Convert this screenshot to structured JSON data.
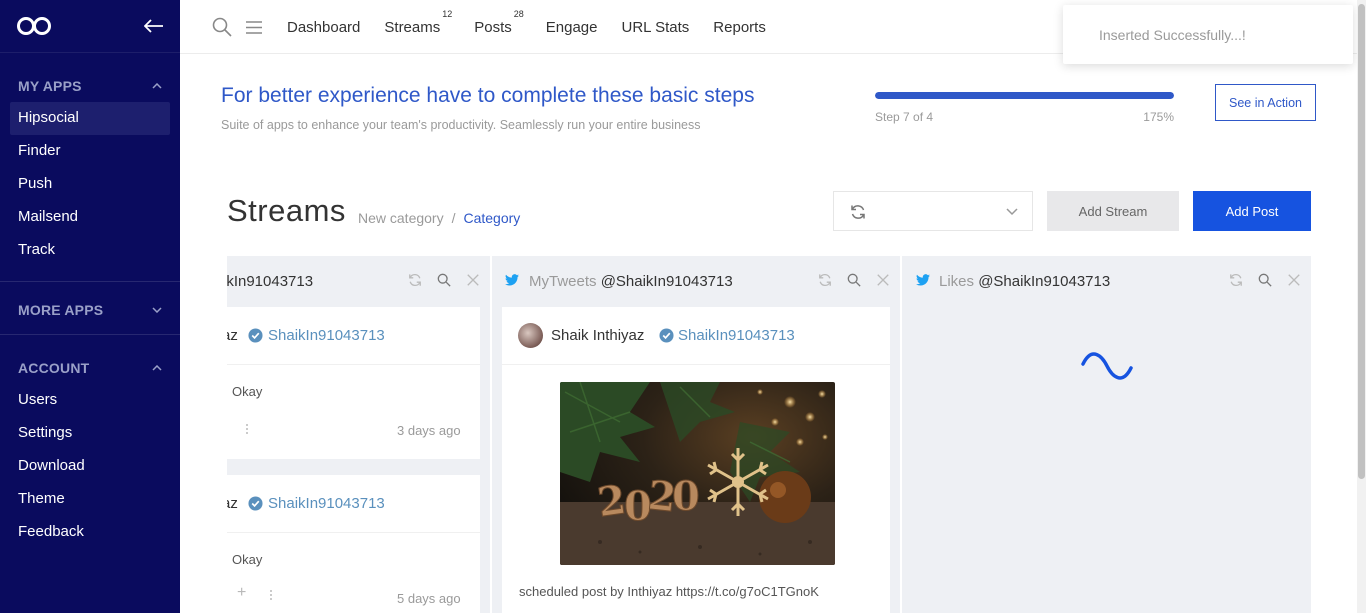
{
  "sidebar": {
    "sections": [
      {
        "title": "MY APPS",
        "items": [
          "Hipsocial",
          "Finder",
          "Push",
          "Mailsend",
          "Track"
        ]
      },
      {
        "title": "MORE APPS",
        "items": []
      },
      {
        "title": "ACCOUNT",
        "items": [
          "Users",
          "Settings",
          "Download",
          "Theme",
          "Feedback"
        ]
      }
    ]
  },
  "topnav": {
    "items": [
      {
        "label": "Dashboard",
        "badge": ""
      },
      {
        "label": "Streams",
        "badge": "12"
      },
      {
        "label": "Posts",
        "badge": "28"
      },
      {
        "label": "Engage",
        "badge": ""
      },
      {
        "label": "URL Stats",
        "badge": ""
      },
      {
        "label": "Reports",
        "badge": ""
      }
    ]
  },
  "toast": {
    "message": "Inserted Successfully...!"
  },
  "steps": {
    "title": "For better experience have to complete these basic steps",
    "subtitle": "Suite of apps to enhance your team's productivity. Seamlessly run your entire business",
    "step_label": "Step 7 of 4",
    "percent_label": "175%",
    "progress": 1.0,
    "action_label": "See in Action"
  },
  "streams": {
    "title": "Streams",
    "breadcrumb": [
      "New category",
      "Category"
    ],
    "add_stream_label": "Add Stream",
    "add_post_label": "Add Post"
  },
  "columns": [
    {
      "title": "ikIn91043713",
      "cards": [
        {
          "name": "az",
          "handle": "ShaikIn91043713",
          "text": "Okay",
          "ago": "3 days ago"
        },
        {
          "name": "az",
          "handle": "ShaikIn91043713",
          "text": "Okay",
          "ago": "5 days ago"
        }
      ]
    },
    {
      "title_prefix": "MyTweets",
      "title_handle": "@ShaikIn91043713",
      "card": {
        "name": "Shaik Inthiyaz",
        "handle": "ShaikIn91043713",
        "text": "scheduled post by Inthiyaz https://t.co/g7oC1TGnoK"
      }
    },
    {
      "title_prefix": "Likes",
      "title_handle": "@ShaikIn91043713"
    }
  ],
  "colors": {
    "sidebar_bg": "#0a0b5e",
    "accent": "#2f58c8",
    "primary_button": "#1653e0",
    "twitter": "#1da1f2"
  }
}
